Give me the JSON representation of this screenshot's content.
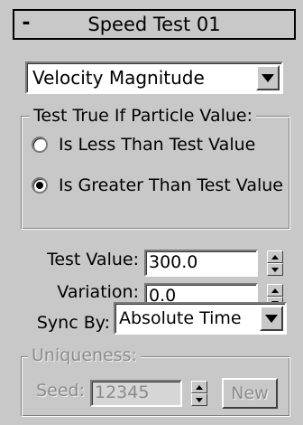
{
  "rollout": {
    "collapse_symbol": "-",
    "title": "Speed Test 01"
  },
  "test_channel": {
    "selected": "Velocity Magnitude"
  },
  "condition_group": {
    "legend": "Test True If Particle Value:",
    "options": [
      {
        "label": "Is Less Than Test Value",
        "checked": false
      },
      {
        "label": "Is Greater Than Test Value",
        "checked": true
      }
    ]
  },
  "test_value": {
    "label": "Test Value:",
    "value": "300.0"
  },
  "variation": {
    "label": "Variation:",
    "value": "0.0"
  },
  "sync_by": {
    "label": "Sync By:",
    "selected": "Absolute Time"
  },
  "uniqueness": {
    "legend": "Uniqueness:",
    "seed_label": "Seed:",
    "seed_value": "12345",
    "new_button": "New",
    "enabled": false
  },
  "icons": {
    "dropdown_arrow": "triangle-down-icon",
    "spinner_up": "triangle-up-icon",
    "spinner_down": "triangle-down-icon",
    "radio_checked": "filled-dot-icon"
  },
  "colors": {
    "panel_bg": "#c8c8c8",
    "field_bg": "#ffffff",
    "disabled_text": "#8c8c8c"
  }
}
